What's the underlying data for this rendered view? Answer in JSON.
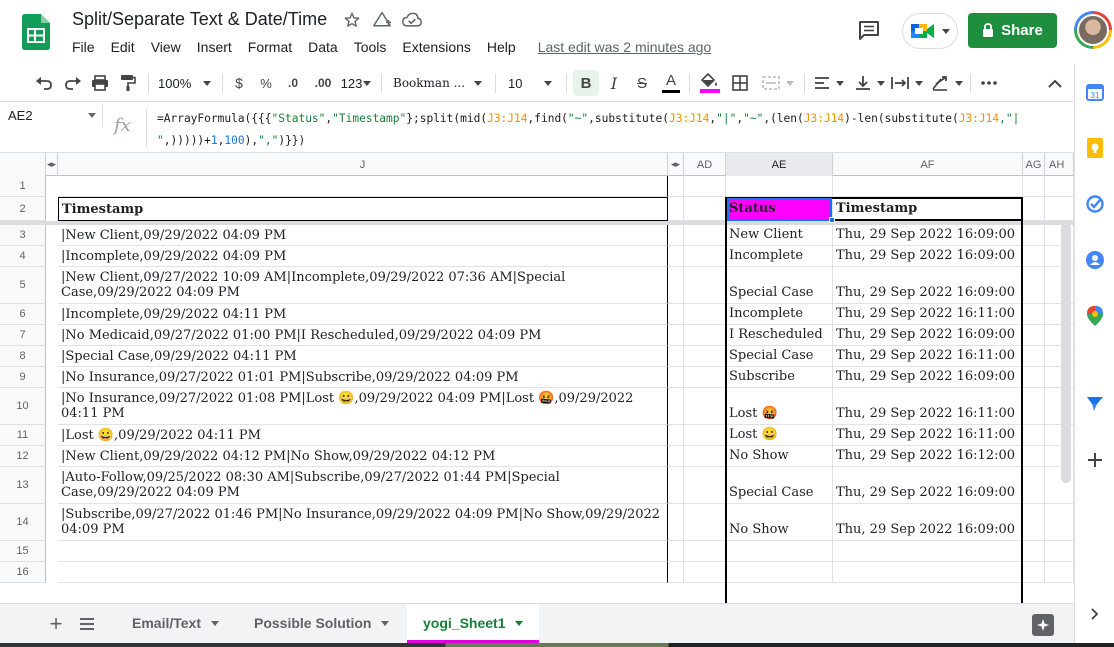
{
  "document": {
    "title": "Split/Separate Text & Date/Time",
    "last_edit": "Last edit was 2 minutes ago"
  },
  "menu": [
    "File",
    "Edit",
    "View",
    "Insert",
    "Format",
    "Data",
    "Tools",
    "Extensions",
    "Help"
  ],
  "header_buttons": {
    "share_label": "Share"
  },
  "toolbar": {
    "zoom": "100%",
    "currency": "$",
    "percent": "%",
    "decrease_decimals": ".0",
    "increase_decimals": ".00",
    "more_formats": "123",
    "font_family": "Bookman ...",
    "font_size": "10",
    "bold": "B",
    "italic": "I",
    "strikethrough": "S",
    "text_color_letter": "A",
    "fill_color": "#ff00ff",
    "text_color": "#000000"
  },
  "formula_bar": {
    "cell_ref": "AE2",
    "fx": "fx",
    "formula_parts": [
      {
        "t": "=ArrayFormula({{{",
        "c": "plain"
      },
      {
        "t": "\"Status\"",
        "c": "str"
      },
      {
        "t": ",",
        "c": "plain"
      },
      {
        "t": "\"Timestamp\"",
        "c": "str"
      },
      {
        "t": "};split(mid(",
        "c": "plain"
      },
      {
        "t": "J3:J14",
        "c": "ref"
      },
      {
        "t": ",find(",
        "c": "plain"
      },
      {
        "t": "\"~\"",
        "c": "str"
      },
      {
        "t": ",substitute(",
        "c": "plain"
      },
      {
        "t": "J3:J14",
        "c": "ref"
      },
      {
        "t": ",",
        "c": "plain"
      },
      {
        "t": "\"|\"",
        "c": "str"
      },
      {
        "t": ",",
        "c": "plain"
      },
      {
        "t": "\"~\"",
        "c": "str"
      },
      {
        "t": ",(len(",
        "c": "plain"
      },
      {
        "t": "J3:J14",
        "c": "ref"
      },
      {
        "t": ")-len(substitute(",
        "c": "plain"
      },
      {
        "t": "J3:J14",
        "c": "ref"
      },
      {
        "t": ",\"|",
        "c": "str"
      },
      {
        "t": "\n\"",
        "c": "str"
      },
      {
        "t": ",)))))+",
        "c": "plain"
      },
      {
        "t": "1",
        "c": "num"
      },
      {
        "t": ",",
        "c": "plain"
      },
      {
        "t": "100",
        "c": "num"
      },
      {
        "t": "),",
        "c": "plain"
      },
      {
        "t": "\",\"",
        "c": "str"
      },
      {
        "t": ")}})",
        "c": "plain"
      }
    ]
  },
  "columns": {
    "j": "J",
    "ad": "AD",
    "ae": "AE",
    "af": "AF",
    "ag": "AG",
    "ah": "AH"
  },
  "header_row": {
    "j": "Timestamp",
    "ae": "Status",
    "af": "Timestamp"
  },
  "rows": [
    {
      "num": "1",
      "j": "",
      "ae": "",
      "af": ""
    },
    {
      "num": "2",
      "j": "Timestamp",
      "ae": "Status",
      "af": "Timestamp"
    },
    {
      "num": "3",
      "j": "|New Client,09/29/2022 04:09 PM",
      "ae": "New Client",
      "af": "Thu, 29 Sep 2022 16:09:00"
    },
    {
      "num": "4",
      "j": "|Incomplete,09/29/2022 04:09 PM",
      "ae": "Incomplete",
      "af": "Thu, 29 Sep 2022 16:09:00"
    },
    {
      "num": "5",
      "j": "|New Client,09/27/2022 10:09 AM|Incomplete,09/29/2022 07:36 AM|Special Case,09/29/2022 04:09 PM",
      "ae": "Special Case",
      "af": "Thu, 29 Sep 2022 16:09:00"
    },
    {
      "num": "6",
      "j": "|Incomplete,09/29/2022 04:11 PM",
      "ae": "Incomplete",
      "af": "Thu, 29 Sep 2022 16:11:00"
    },
    {
      "num": "7",
      "j": "|No Medicaid,09/27/2022 01:00 PM|I Rescheduled,09/29/2022 04:09 PM",
      "ae": "I Rescheduled",
      "af": "Thu, 29 Sep 2022 16:09:00"
    },
    {
      "num": "8",
      "j": "|Special Case,09/29/2022 04:11 PM",
      "ae": "Special Case",
      "af": "Thu, 29 Sep 2022 16:11:00"
    },
    {
      "num": "9",
      "j": "|No Insurance,09/27/2022 01:01 PM|Subscribe,09/29/2022 04:09 PM",
      "ae": "Subscribe",
      "af": "Thu, 29 Sep 2022 16:09:00"
    },
    {
      "num": "10",
      "j": "|No Insurance,09/27/2022 01:08 PM|Lost 😀,09/29/2022 04:09 PM|Lost 🤬,09/29/2022 04:11 PM",
      "ae": "Lost 🤬",
      "af": "Thu, 29 Sep 2022 16:11:00"
    },
    {
      "num": "11",
      "j": "|Lost 😀,09/29/2022 04:11 PM",
      "ae": "Lost 😀",
      "af": "Thu, 29 Sep 2022 16:11:00"
    },
    {
      "num": "12",
      "j": "|New Client,09/29/2022 04:12 PM|No Show,09/29/2022 04:12 PM",
      "ae": "No Show",
      "af": "Thu, 29 Sep 2022 16:12:00"
    },
    {
      "num": "13",
      "j": "|Auto-Follow,09/25/2022 08:30 AM|Subscribe,09/27/2022 01:44 PM|Special Case,09/29/2022 04:09 PM",
      "ae": "Special Case",
      "af": "Thu, 29 Sep 2022 16:09:00"
    },
    {
      "num": "14",
      "j": "|Subscribe,09/27/2022 01:46 PM|No Insurance,09/29/2022 04:09 PM|No Show,09/29/2022 04:09 PM",
      "ae": "No Show",
      "af": "Thu, 29 Sep 2022 16:09:00"
    },
    {
      "num": "15",
      "j": "",
      "ae": "",
      "af": ""
    },
    {
      "num": "16",
      "j": "",
      "ae": "",
      "af": ""
    }
  ],
  "sheets": [
    {
      "name": "Email/Text",
      "active": false
    },
    {
      "name": "Possible Solution",
      "active": false
    },
    {
      "name": "yogi_Sheet1",
      "active": true
    }
  ],
  "colors": {
    "status_header_fill": "#ff00ff",
    "share_button": "#1e8e3e",
    "active_tab_text": "#188038"
  },
  "icons": {
    "sheets_logo": "sheets-logo-icon",
    "star": "star-icon",
    "move": "move-to-folder-icon",
    "cloud": "cloud-saved-icon",
    "comments": "comment-icon",
    "meet": "meet-icon",
    "lock": "lock-icon"
  }
}
